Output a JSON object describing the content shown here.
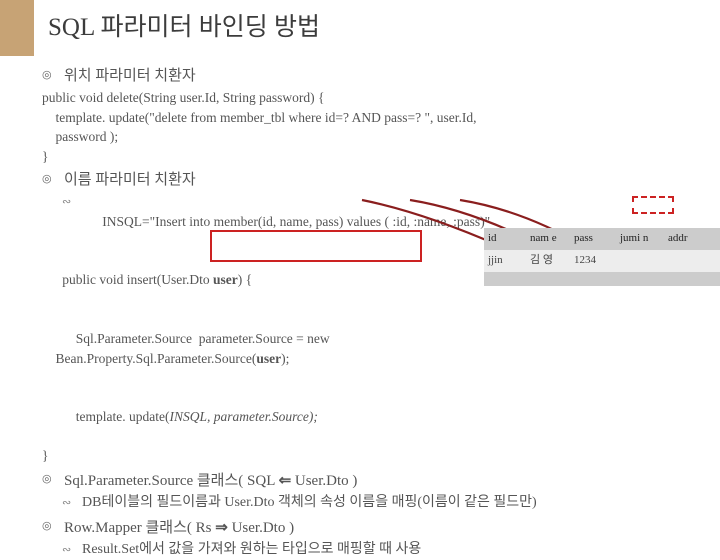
{
  "title": "SQL 파라미터 바인딩 방법",
  "b1": "위치 파라미터 치환자",
  "code1": "public void delete(String user.Id, String password) {\n    template. update(\"delete from member_tbl where id=? AND pass=? \", user.Id,\n    password );\n}",
  "b2": "이름 파라미터 치환자",
  "sub1_prefix": "INSQL=\"Insert into member(id, name, pass) values ( ",
  "sub1_bind": ":id, :name, :pass",
  "sub1_suffix": ")\"",
  "code2a": "public void insert(User.Dto ",
  "code2a_bold": "user",
  "code2a_end": ") {",
  "code2b_pre": "    Sql.Parameter.Source  parameter.Source = new\n    Bean.Property.Sql.Parameter.Source(",
  "code2b_bold": "user",
  "code2b_end": ");",
  "code2c": "    template. update(",
  "code2c_ital": "INSQL, parameter.Source);",
  "code2d": "}",
  "b3_pre": "Sql.Parameter.Source 클래스( SQL  ",
  "b3_arrow": "⇐",
  "b3_post": " User.Dto )",
  "sub3": "DB테이블의 필드이름과 User.Dto 객체의 속성 이름을 매핑(이름이 같은 필드만)",
  "b4_pre": "Row.Mapper 클래스( Rs ",
  "b4_arrow": "⇒",
  "b4_post": " User.Dto )",
  "sub4": "Result.Set에서 값을 가져와 원하는 타입으로 매핑할 때 사용",
  "table": {
    "headers": [
      "id",
      "nam\ne",
      "pass",
      "jumi\nn",
      "addr"
    ],
    "row": [
      "jjin",
      "김 영",
      "1234",
      "",
      ""
    ]
  }
}
